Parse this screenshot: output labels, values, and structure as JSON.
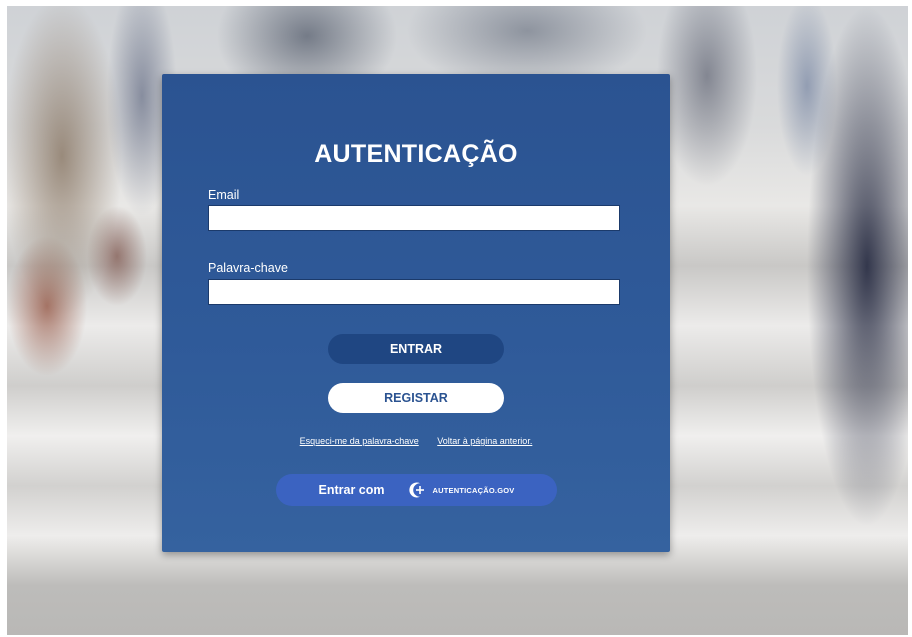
{
  "login": {
    "title": "AUTENTICAÇÃO",
    "email_label": "Email",
    "email_value": "",
    "password_label": "Palavra-chave",
    "password_value": "",
    "enter_button": "ENTRAR",
    "register_button": "REGISTAR",
    "forgot_link": "Esqueci-me da palavra-chave",
    "back_link": "Voltar à página anterior.",
    "gov_button_text": "Entrar com",
    "gov_brand": "AUTENTICAÇÃO.GOV"
  },
  "icons": {
    "gov_logo": "autenticacao-gov-logo-icon"
  },
  "colors": {
    "card_background": "#2b5391",
    "primary_button": "#1f4682",
    "gov_button": "#3b63c1",
    "text": "#ffffff"
  }
}
